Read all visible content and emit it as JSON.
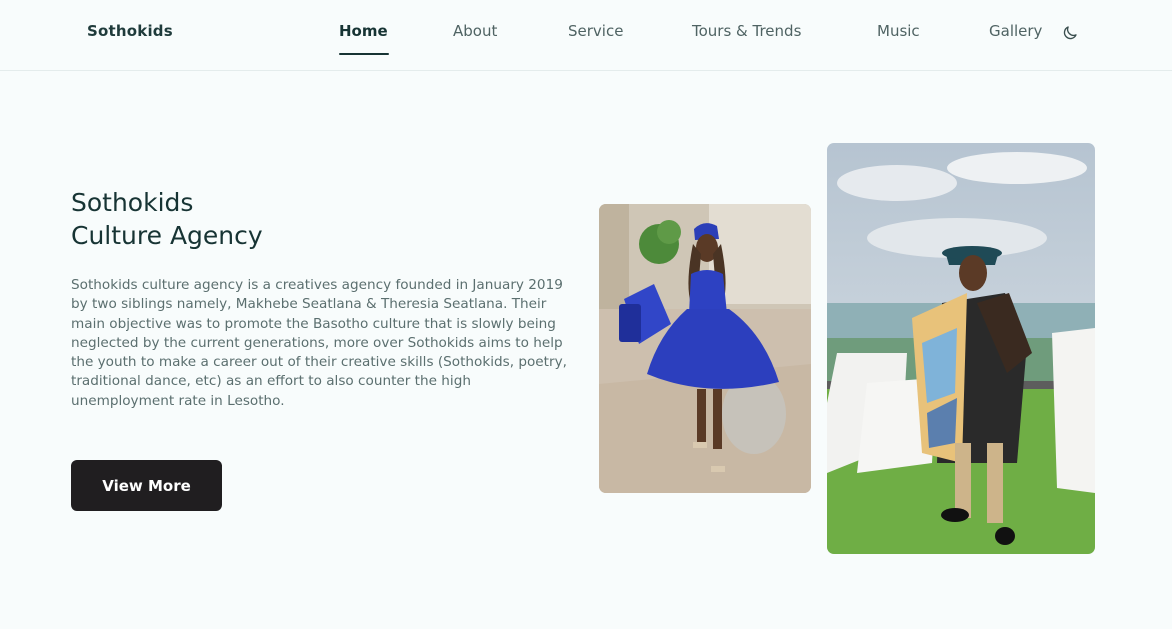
{
  "header": {
    "brand": "Sothokids",
    "nav": [
      "Home",
      "About",
      "Service",
      "Tours & Trends",
      "Music",
      "Gallery"
    ],
    "active_nav": "Home",
    "theme_toggle_icon": "moon-icon"
  },
  "hero": {
    "title_line1": "Sothokids",
    "title_line2": "Culture Agency",
    "description": "Sothokids culture agency is a creatives agency founded in January 2019 by two siblings namely, Makhebe Seatlana & Theresia Seatlana. Their main objective was to promote the Basotho culture that is slowly being neglected by the current generations, more over Sothokids aims to help the youth to make a career out of their creative skills (Sothokids, poetry, traditional dance, etc) as an effort to also counter the high unemployment rate in Lesotho.",
    "button": "View More"
  },
  "colors": {
    "background": "#f8fcfc",
    "heading": "#173434",
    "body_text": "#5b6f6f",
    "button_bg": "#201e20",
    "button_text": "#ffffff"
  }
}
